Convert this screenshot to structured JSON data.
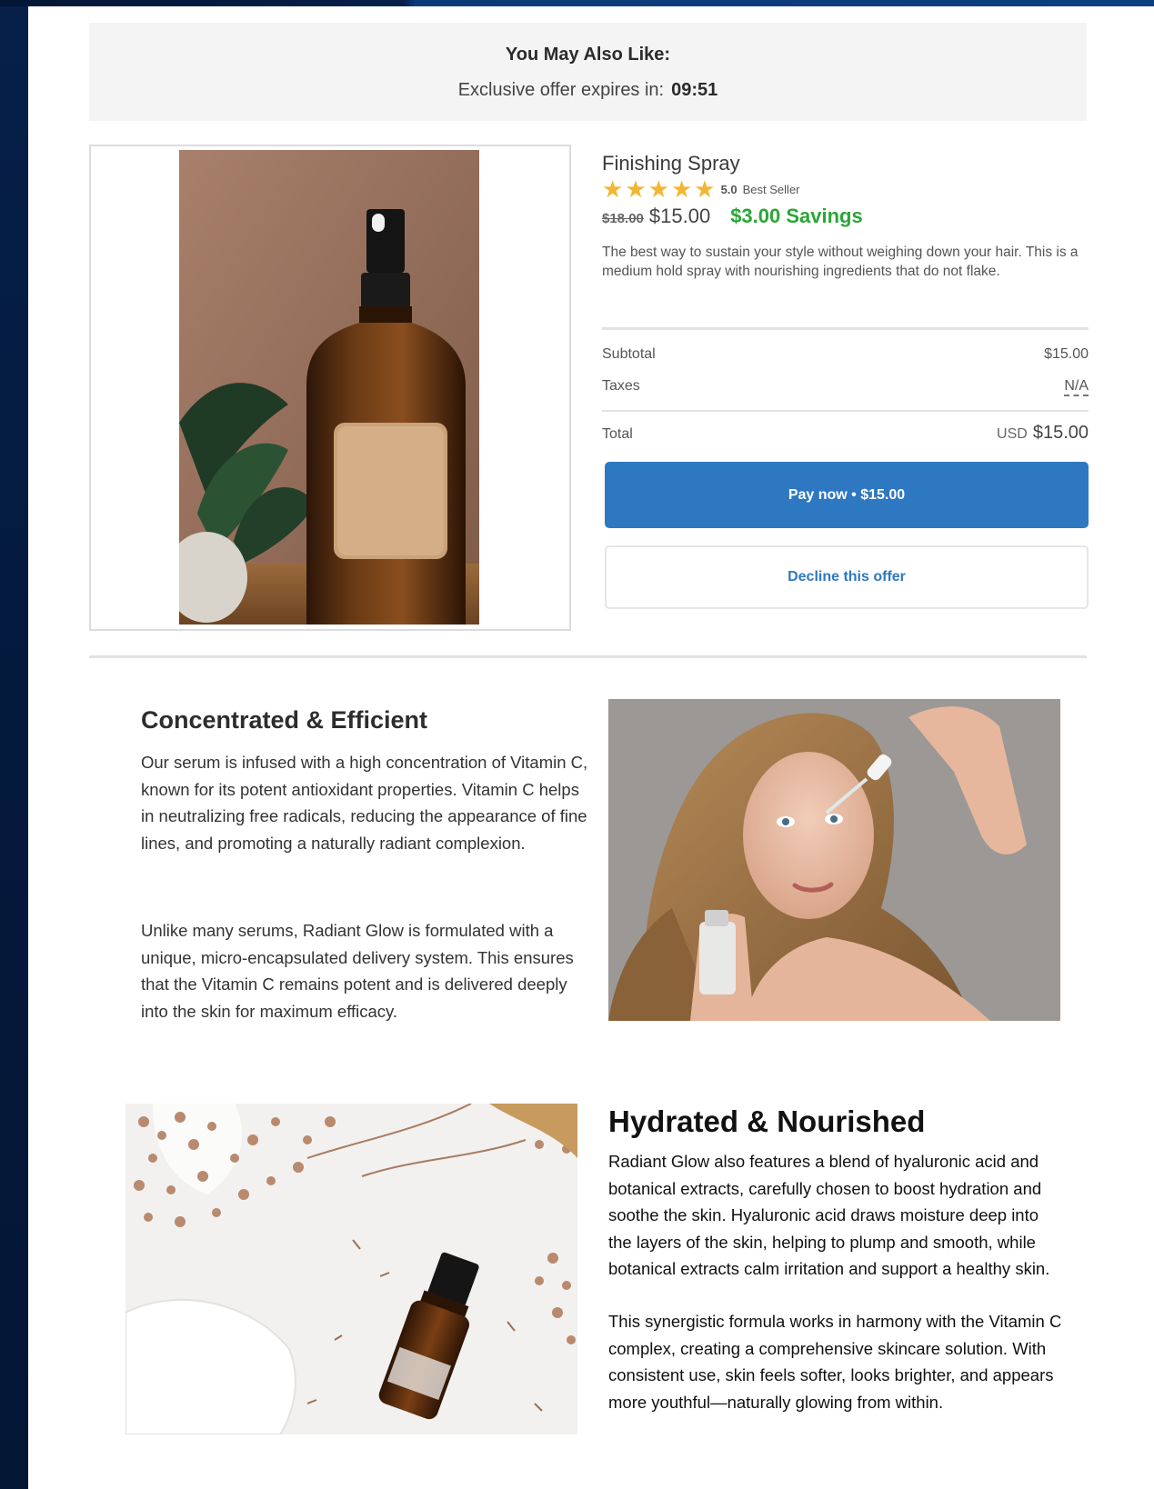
{
  "offer": {
    "title": "You May Also Like:",
    "expires_label": "Exclusive offer expires in:",
    "timer": "09:51"
  },
  "product": {
    "name": "Finishing Spray",
    "rating": "5.0",
    "rating_stars": 5,
    "badge": "Best Seller",
    "old_price": "$18.00",
    "price": "$15.00",
    "savings": "$3.00 Savings",
    "description": "The best way to sustain your style without weighing down your hair. This is a medium hold spray with nourishing ingredients that do not flake."
  },
  "summary": {
    "subtotal_label": "Subtotal",
    "subtotal_value": "$15.00",
    "taxes_label": "Taxes",
    "taxes_value": "N/A",
    "total_label": "Total",
    "currency": "USD",
    "total_value": "$15.00"
  },
  "buttons": {
    "pay": "Pay now • $15.00",
    "decline": "Decline this offer"
  },
  "sections": [
    {
      "heading": "Concentrated & Efficient",
      "paragraph1": "Our serum is infused with a high concentration of Vitamin C, known for its potent antioxidant properties. Vitamin C helps in neutralizing free radicals, reducing the appearance of fine lines, and promoting a naturally radiant complexion.",
      "paragraph2": "Unlike many serums, Radiant Glow is formulated with a unique, micro-encapsulated delivery system. This ensures that the Vitamin C remains potent and is delivered deeply into the skin for maximum efficacy."
    },
    {
      "heading": "Hydrated & Nourished",
      "paragraph1": "Radiant Glow also features a blend of hyaluronic acid and botanical extracts, carefully chosen to boost hydration and soothe the skin. Hyaluronic acid draws moisture deep into the layers of the skin, helping to plump and smooth, while botanical extracts calm irritation and support a healthy skin.",
      "paragraph2": "This synergistic formula works in harmony with the Vitamin C complex, creating a comprehensive skincare solution. With consistent use, skin feels softer, looks brighter, and appears more youthful—naturally glowing from within."
    }
  ],
  "colors": {
    "page_bg": "#041a3d",
    "pay_button": "#2e78c2",
    "savings_green": "#2aa637",
    "star": "#f2b632"
  }
}
